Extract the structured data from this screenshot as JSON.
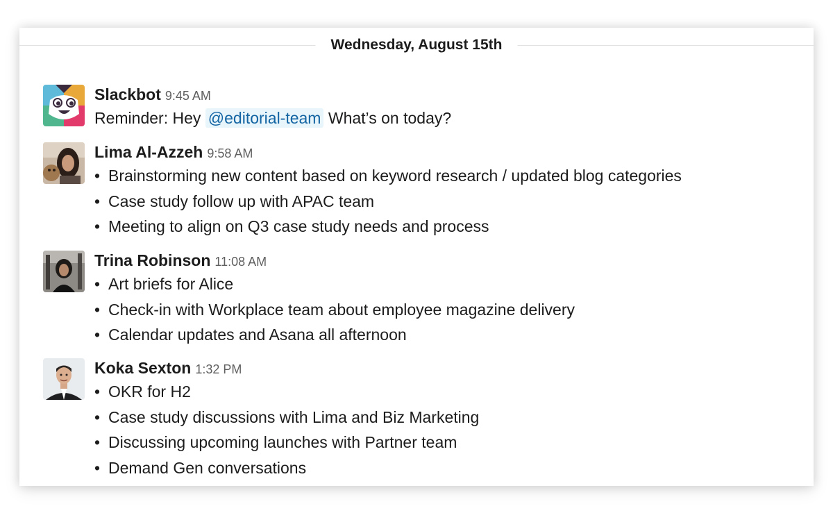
{
  "day_divider": "Wednesday, August 15th",
  "messages": [
    {
      "sender": "Slackbot",
      "time": "9:45 AM",
      "avatar": "slackbot-icon",
      "text_prefix": "Reminder: Hey",
      "mention": "@editorial-team",
      "text_suffix": "What’s on today?"
    },
    {
      "sender": "Lima Al-Azzeh",
      "time": "9:58 AM",
      "avatar": "user-photo",
      "bullets": [
        "Brainstorming new content based on keyword research / updated blog categories",
        "Case study follow up with APAC team",
        "Meeting to align on Q3 case study needs and process"
      ]
    },
    {
      "sender": "Trina Robinson",
      "time": "11:08 AM",
      "avatar": "user-photo",
      "bullets": [
        "Art briefs for Alice",
        "Check-in with Workplace team about employee magazine delivery",
        "Calendar updates and Asana all afternoon"
      ]
    },
    {
      "sender": "Koka Sexton",
      "time": "1:32 PM",
      "avatar": "user-photo",
      "bullets": [
        "OKR for H2",
        "Case study discussions with Lima and Biz Marketing",
        "Discussing upcoming launches with Partner team",
        "Demand Gen conversations"
      ]
    }
  ],
  "bullet_char": "•",
  "colors": {
    "mention_text": "#1264a3",
    "mention_bg": "#e8f5fa",
    "timestamp": "#616061",
    "text": "#1d1c1d"
  }
}
